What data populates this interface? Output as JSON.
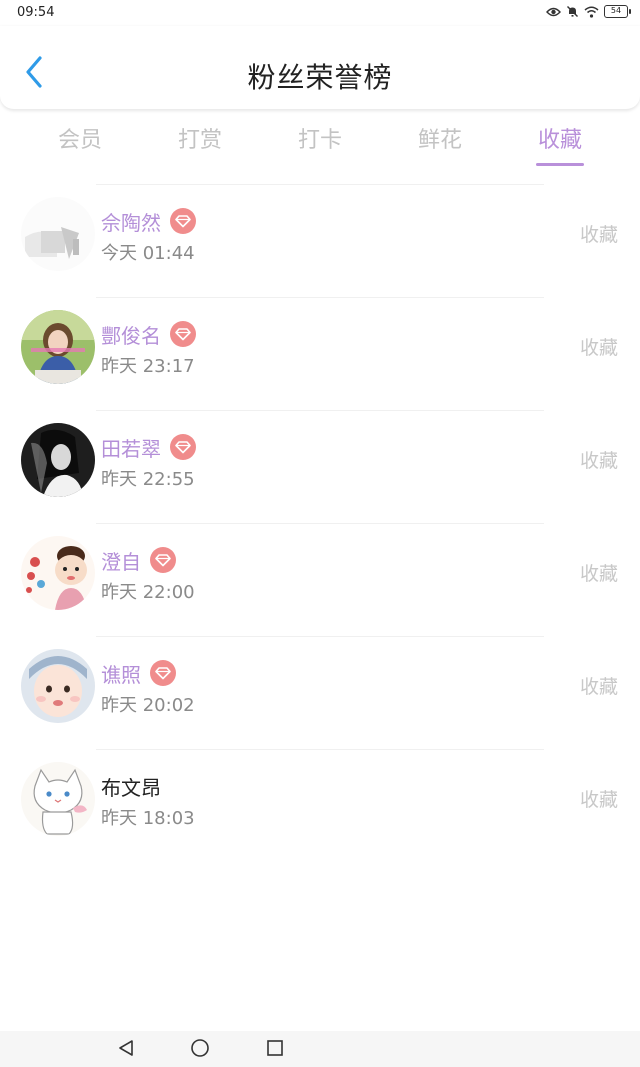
{
  "status_bar": {
    "time": "09:54",
    "battery": "54"
  },
  "header": {
    "title": "粉丝荣誉榜"
  },
  "tabs": [
    {
      "label": "会员",
      "active": false
    },
    {
      "label": "打赏",
      "active": false
    },
    {
      "label": "打卡",
      "active": false
    },
    {
      "label": "鲜花",
      "active": false
    },
    {
      "label": "收藏",
      "active": true
    }
  ],
  "list": [
    {
      "name": "佘陶然",
      "time": "今天 01:44",
      "action": "收藏",
      "vip": true
    },
    {
      "name": "酆俊名",
      "time": "昨天 23:17",
      "action": "收藏",
      "vip": true
    },
    {
      "name": "田若翠",
      "time": "昨天 22:55",
      "action": "收藏",
      "vip": true
    },
    {
      "name": "澄自",
      "time": "昨天 22:00",
      "action": "收藏",
      "vip": true
    },
    {
      "name": "谯照",
      "time": "昨天 20:02",
      "action": "收藏",
      "vip": true
    },
    {
      "name": "布文昂",
      "time": "昨天 18:03",
      "action": "收藏",
      "vip": false
    }
  ],
  "colors": {
    "accent": "#b990da",
    "name_vip": "#b48fd8",
    "badge": "#f08c8c",
    "back": "#2f9be8",
    "muted": "#c8c8c8"
  }
}
